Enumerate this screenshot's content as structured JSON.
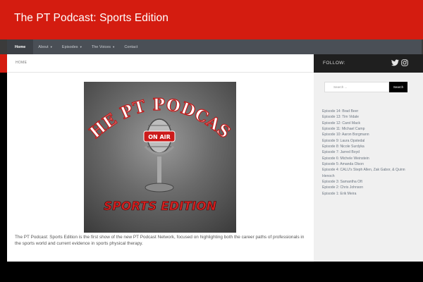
{
  "header": {
    "site_title": "The PT Podcast: Sports Edition"
  },
  "nav": {
    "items": [
      {
        "label": "Home",
        "active": true,
        "has_dropdown": false
      },
      {
        "label": "About",
        "active": false,
        "has_dropdown": true
      },
      {
        "label": "Episodes",
        "active": false,
        "has_dropdown": true
      },
      {
        "label": "The Voices",
        "active": false,
        "has_dropdown": true
      },
      {
        "label": "Contact",
        "active": false,
        "has_dropdown": false
      }
    ]
  },
  "breadcrumb": "HOME",
  "main": {
    "cover": {
      "title": "THE PT PODCAST",
      "on_air": "ON AIR",
      "subtitle": "SPORTS EDITION"
    },
    "intro": "The PT Podcast: Sports Edition is the first show of the new PT Podcast Network, focused on highlighting both the career paths of professionals in the sports world and current evidence in sports physical therapy."
  },
  "sidebar": {
    "follow_label": "FOLLOW:",
    "social_icons": [
      "twitter-icon",
      "instagram-icon"
    ],
    "search": {
      "placeholder": "Search ...",
      "button_label": "Search"
    },
    "episodes": [
      "Episode 14: Brad Beer",
      "Episode 13: Tim Vidale",
      "Episode 12: Carol Mack",
      "Episode 11: Michael Camp",
      "Episode 10: Aaron Borgmann",
      "Episode 9: Laura Opstedal",
      "Episode 8: Nicole Surdyka",
      "Episode 7: Jarred Boyd",
      "Episode 6: Michele Weinstein",
      "Episode 5: Amanda Olson",
      "Episode 4: CALU's Steph Allen, Zak Gabor, & Quinn Henoch",
      "Episode 3: Samantha Oft",
      "Episode 2: Chris Johnson",
      "Episode 1: Erik Meira"
    ]
  },
  "colors": {
    "header_red": "#d41c10",
    "nav_bg": "#4a4f56",
    "sidebar_head": "#1f1f1f",
    "sidebar_bg": "#f0f0f0"
  }
}
